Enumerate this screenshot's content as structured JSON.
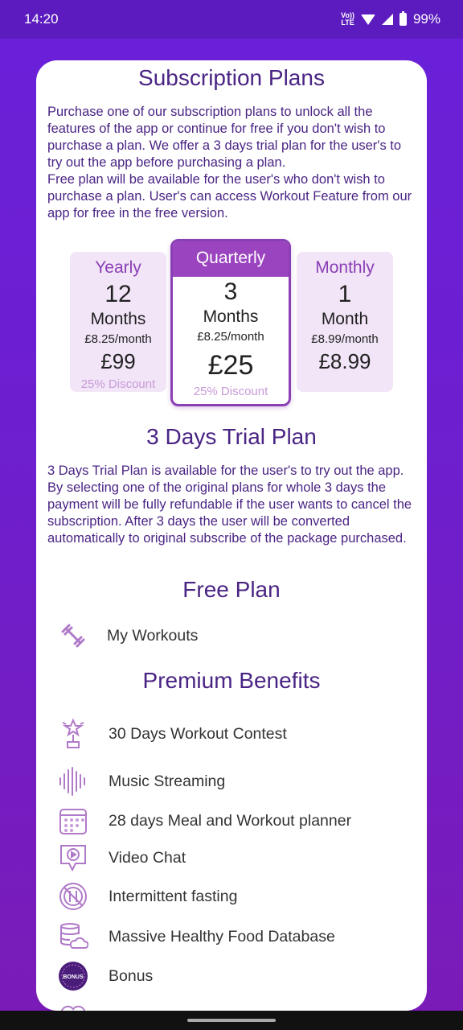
{
  "status_bar": {
    "time": "14:20",
    "lte": "Vo)) LTE",
    "battery": "99%"
  },
  "intro": {
    "title": "Subscription Plans",
    "text": "Purchase one of our subscription plans to unlock all the features of the app or continue for free if you don't wish to purchase a plan. We offer a 3 days trial plan for the user's to try out the app before purchasing a plan.\nFree plan will be available for the user's who don't wish to purchase a plan. User's can access Workout Feature from our app for free in the free version."
  },
  "plans": [
    {
      "name": "Yearly",
      "count": "12",
      "unit": "Months",
      "per_month": "£8.25/month",
      "price": "£99",
      "discount": "25% Discount"
    },
    {
      "name": "Quarterly",
      "count": "3",
      "unit": "Months",
      "per_month": "£8.25/month",
      "price": "£25",
      "discount": "25% Discount"
    },
    {
      "name": "Monthly",
      "count": "1",
      "unit": "Month",
      "per_month": "£8.99/month",
      "price": "£8.99",
      "discount": ""
    }
  ],
  "trial": {
    "title": "3 Days Trial Plan",
    "text": "3 Days Trial Plan is available for the user's to try out the app. By selecting one of the original plans for whole 3 days the payment will be fully refundable if the user wants to cancel the subscription. After 3 days the user will be converted automatically to original subscribe of the package purchased."
  },
  "free_plan": {
    "title": "Free Plan",
    "items": [
      "My Workouts"
    ]
  },
  "premium": {
    "title": "Premium Benefits",
    "items": [
      "30 Days Workout Contest",
      "Music Streaming",
      "28 days Meal and Workout planner",
      "Video Chat",
      "Intermittent fasting",
      "Massive Healthy Food Database",
      "Bonus"
    ],
    "bonus_badge": "BONUS"
  },
  "colors": {
    "accent": "#8b3fb5",
    "title": "#4a2484",
    "background": "#6a20d9"
  }
}
